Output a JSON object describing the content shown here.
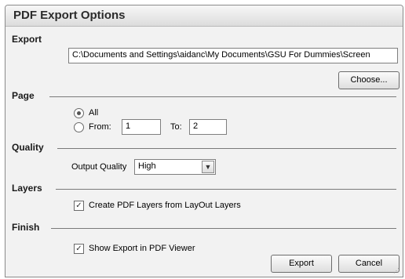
{
  "dialog": {
    "title": "PDF Export Options"
  },
  "export": {
    "label": "Export",
    "path": "C:\\Documents and Settings\\aidanc\\My Documents\\GSU For Dummies\\Screen",
    "choose_label": "Choose..."
  },
  "page": {
    "label": "Page",
    "all_label": "All",
    "from_label": "From:",
    "from_value": "1",
    "to_label": "To:",
    "to_value": "2",
    "selected": "All"
  },
  "quality": {
    "label": "Quality",
    "output_label": "Output Quality",
    "output_value": "High"
  },
  "layers": {
    "label": "Layers",
    "create_label": "Create PDF Layers from LayOut Layers",
    "create_checked": true
  },
  "finish": {
    "label": "Finish",
    "show_label": "Show Export in PDF Viewer",
    "show_checked": true
  },
  "buttons": {
    "export_label": "Export",
    "cancel_label": "Cancel"
  },
  "icons": {
    "radio_selected": "radio-selected-icon",
    "checkbox_checked": "checkmark-icon",
    "dropdown": "chevron-down-icon",
    "resize_grip": "resize-grip-icon"
  }
}
